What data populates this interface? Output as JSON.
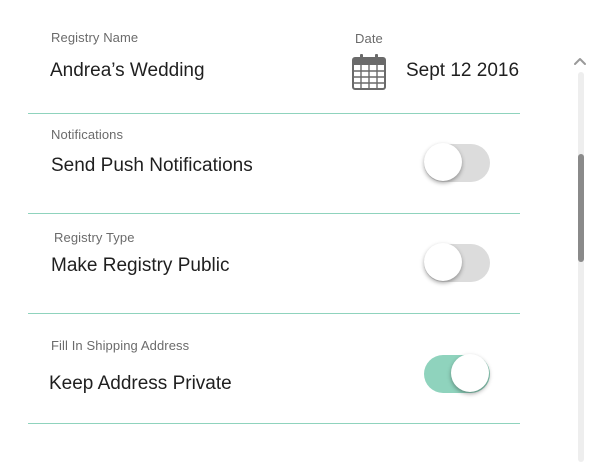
{
  "registry": {
    "name_label": "Registry Name",
    "name_value": "Andrea’s Wedding",
    "date_label": "Date",
    "date_value": "Sept 12 2016"
  },
  "settings": [
    {
      "label": "Notifications",
      "title": "Send Push Notifications",
      "enabled": false
    },
    {
      "label": "Registry Type",
      "title": "Make Registry Public",
      "enabled": false
    },
    {
      "label": "Fill In Shipping Address",
      "title": "Keep Address Private",
      "enabled": true
    }
  ],
  "colors": {
    "accent": "#8fd3bd",
    "toggle_off": "#dcdcdc",
    "text": "#1f1f1f",
    "label": "#6b6b6b"
  },
  "icons": {
    "date": "calendar-icon",
    "scroll_up": "chevron-up-icon"
  }
}
